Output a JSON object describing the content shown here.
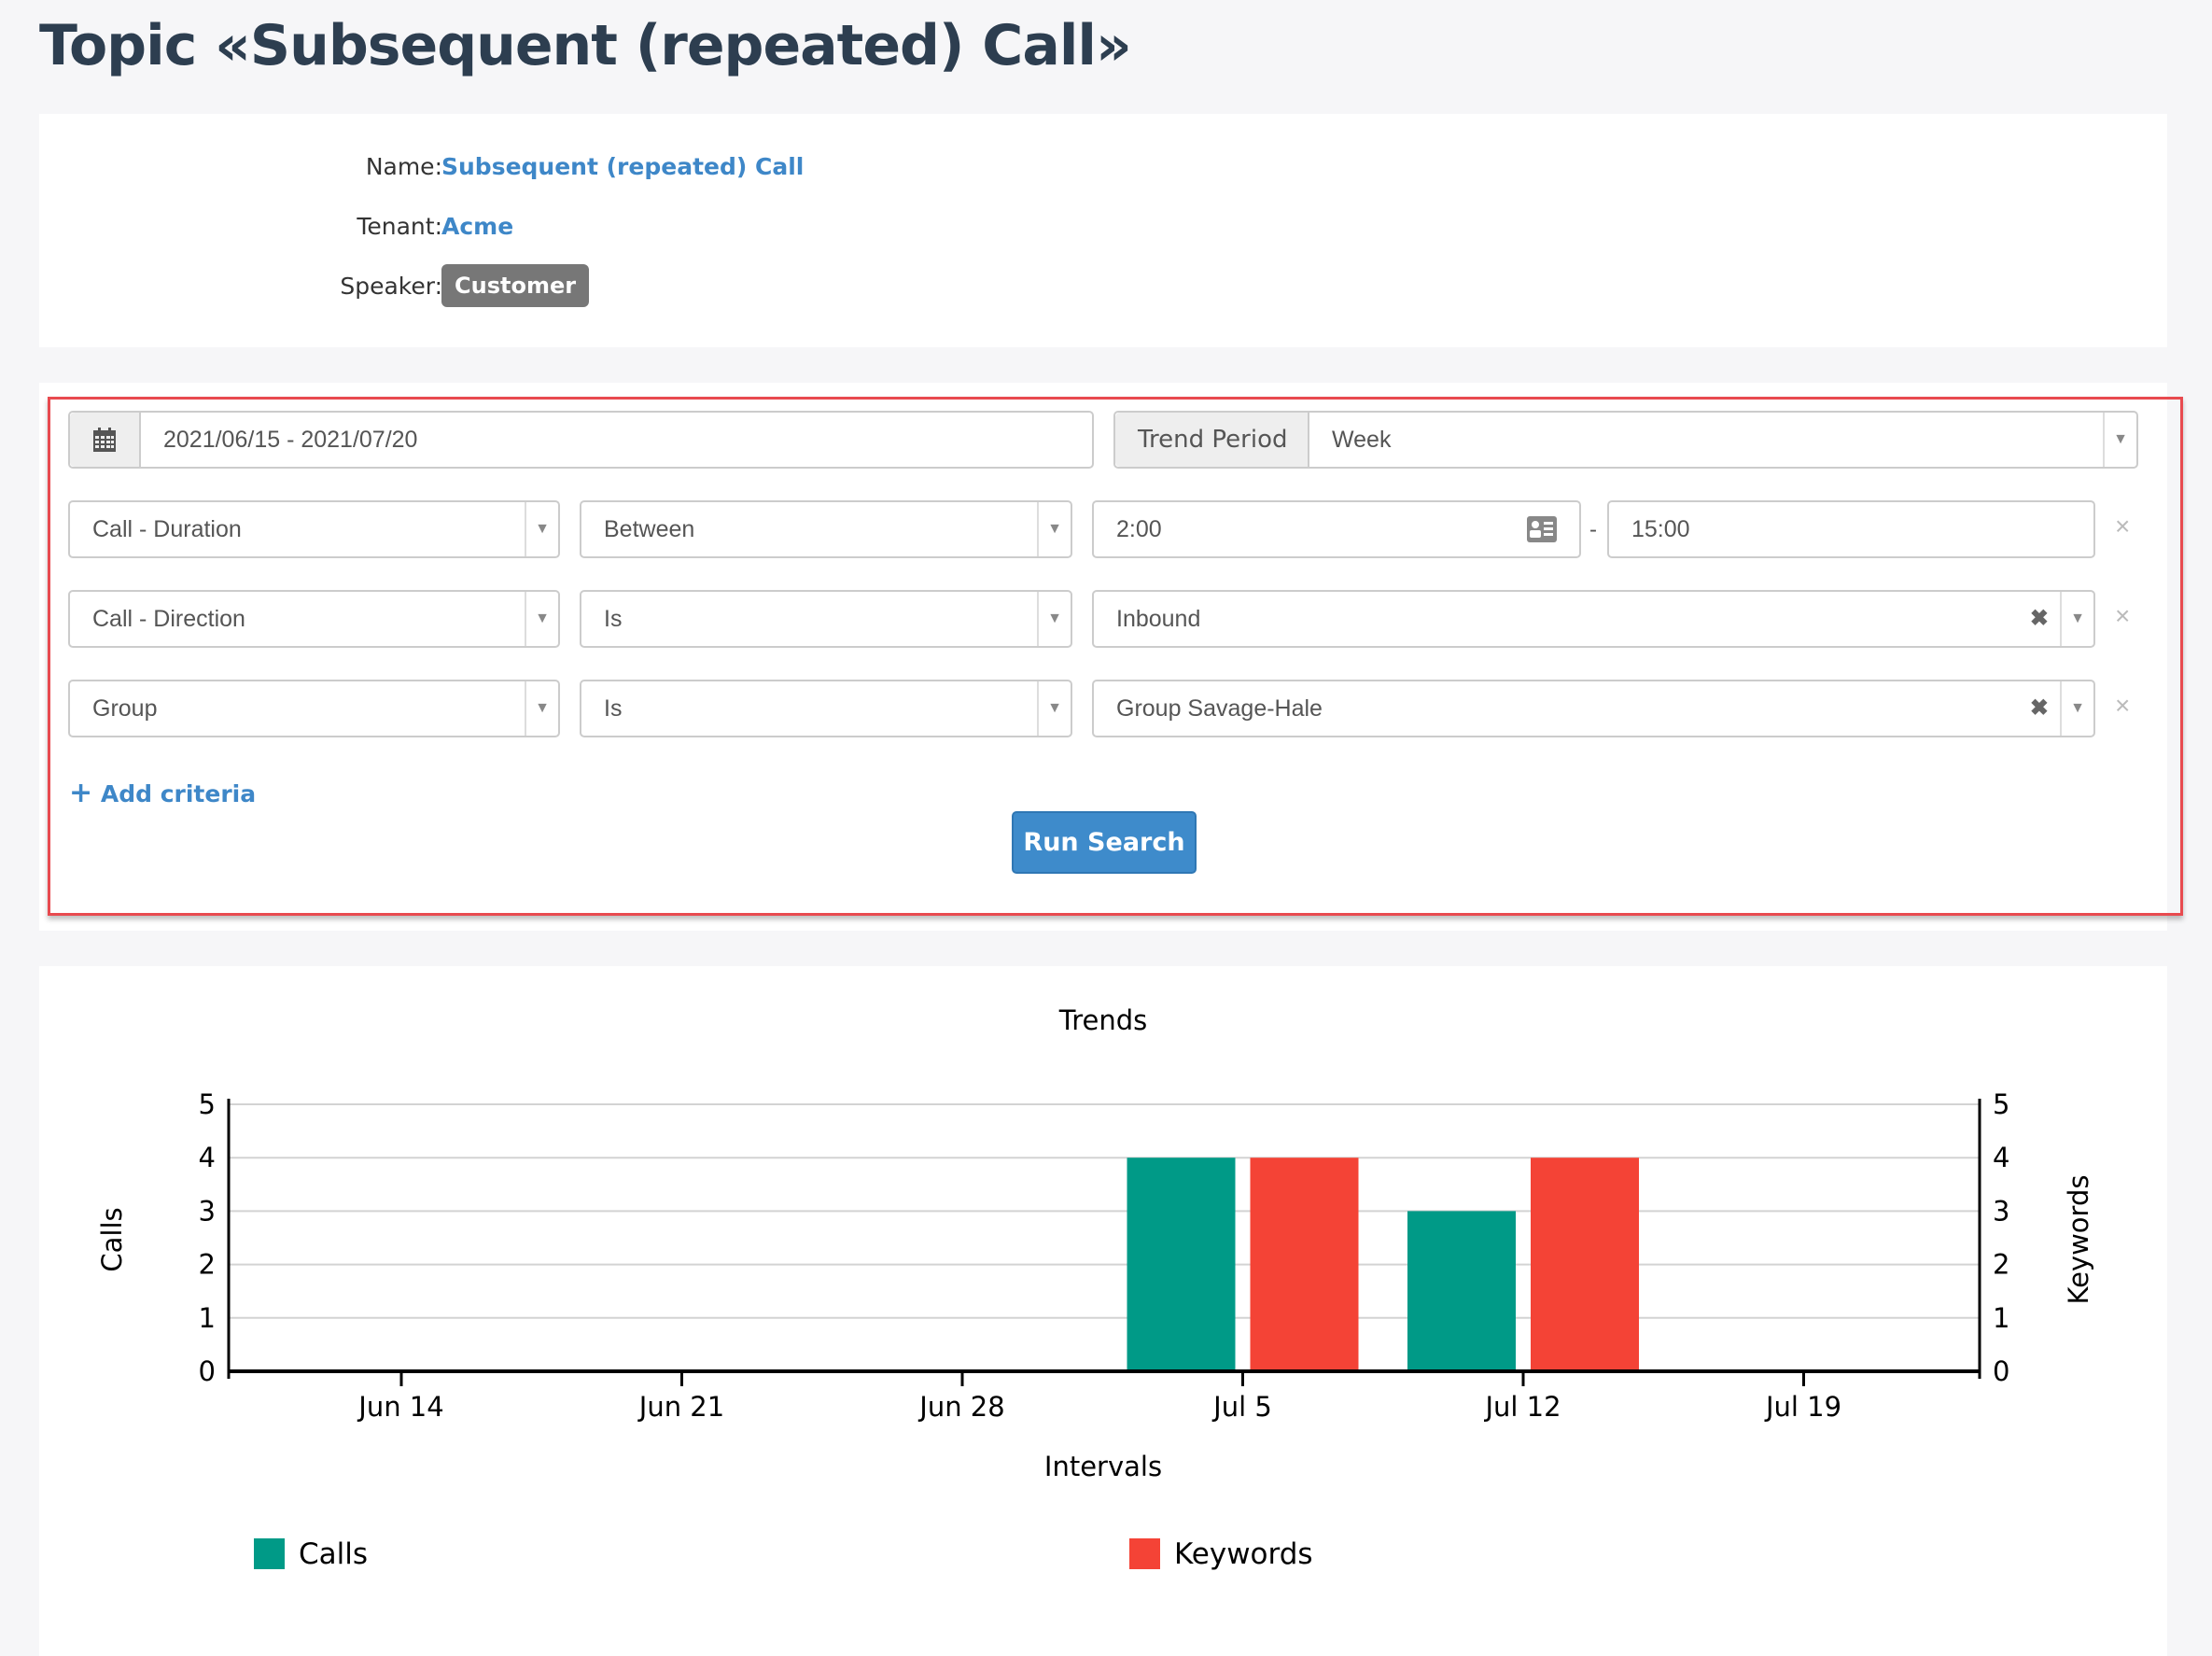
{
  "page": {
    "title": "Topic «Subsequent (repeated) Call»"
  },
  "info": {
    "name_label": "Name:",
    "name_value": "Subsequent (repeated) Call",
    "tenant_label": "Tenant:",
    "tenant_value": "Acme",
    "speaker_label": "Speaker:",
    "speaker_value": "Customer"
  },
  "search": {
    "date_range": "2021/06/15 - 2021/07/20",
    "date_icon": "calendar-icon",
    "trend_period_label": "Trend Period",
    "trend_period_value": "Week",
    "criteria": [
      {
        "field": "Call - Duration",
        "operator": "Between",
        "value_from": "2:00",
        "value_to": "15:00",
        "range_separator": "-"
      },
      {
        "field": "Call - Direction",
        "operator": "Is",
        "value": "Inbound"
      },
      {
        "field": "Group",
        "operator": "Is",
        "value": "Group Savage-Hale"
      }
    ],
    "clear_glyph": "✖",
    "remove_glyph": "×",
    "add_criteria_label": "Add criteria",
    "add_criteria_icon": "+",
    "run_search_label": "Run Search"
  },
  "chart_data": {
    "type": "bar",
    "title": "Trends",
    "xlabel": "Intervals",
    "ylabel": "Calls",
    "y2label": "Keywords",
    "categories": [
      "Jun 14",
      "Jun 21",
      "Jun 28",
      "Jul 5",
      "Jul 12",
      "Jul 19"
    ],
    "series": [
      {
        "name": "Calls",
        "color": "#009a87",
        "axis": "left",
        "values": [
          0,
          0,
          0,
          4,
          3,
          0
        ]
      },
      {
        "name": "Keywords",
        "color": "#f44336",
        "axis": "right",
        "values": [
          0,
          0,
          0,
          4,
          4,
          0
        ]
      }
    ],
    "ylim": [
      0,
      5
    ],
    "y2lim": [
      0,
      5
    ],
    "yticks": [
      "0",
      "1",
      "2",
      "3",
      "4",
      "5"
    ],
    "grid": true,
    "legend": "bottom"
  }
}
